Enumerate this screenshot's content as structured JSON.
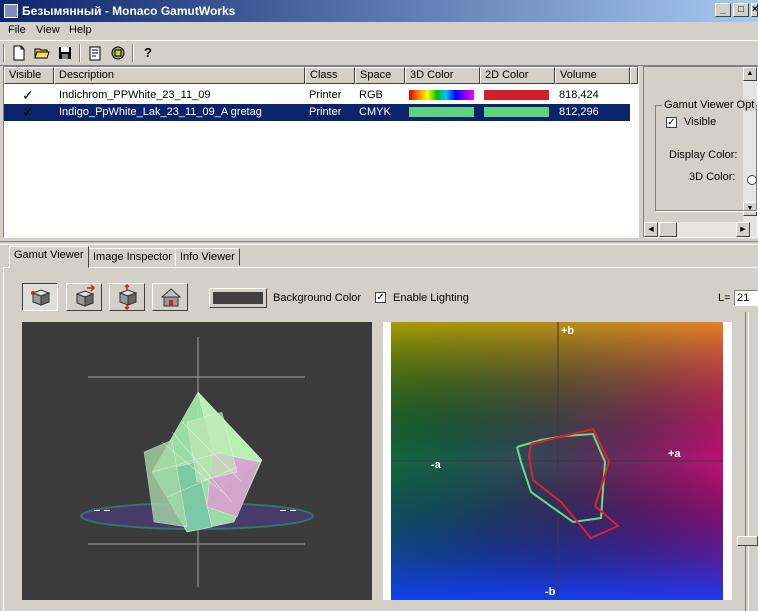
{
  "window": {
    "title": "Безымянный - Monaco GamutWorks"
  },
  "menu": [
    "File",
    "View",
    "Help"
  ],
  "toolbar": {
    "icons": [
      "new-icon",
      "open-icon",
      "save-icon",
      "properties-icon",
      "import-icon",
      "help-icon"
    ],
    "help_glyph": "?"
  },
  "list": {
    "columns": [
      "Visible",
      "Description",
      "Class",
      "Space",
      "3D Color",
      "2D Color",
      "Volume"
    ],
    "rows": [
      {
        "visible": "✓",
        "description": "Indichrom_PPWhite_23_11_09",
        "class": "Printer",
        "space": "RGB",
        "color3d": "rainbow",
        "color2d": "#d0202a",
        "volume": "818,424",
        "selected": false
      },
      {
        "visible": "✓",
        "description": "Indigo_PpWhite_Lak_23_11_09_A gretag",
        "class": "Printer",
        "space": "CMYK",
        "color3d": "#5ed17c",
        "color2d": "#5ed17c",
        "volume": "812,296",
        "selected": true
      }
    ]
  },
  "options_panel": {
    "group_title": "Gamut Viewer Opt",
    "visible_label": "Visible",
    "display_color_label": "Display Color:",
    "color3d_label": "3D Color:"
  },
  "tabs": [
    "Gamut Viewer",
    "Image Inspector",
    "Info Viewer"
  ],
  "viewer": {
    "background_color_label": "Background Color",
    "background_color": "#404040",
    "enable_lighting_label": "Enable Lighting",
    "enable_lighting": true,
    "l_label": "L=",
    "l_value": "21"
  },
  "plot2d": {
    "label_plus_b": "+b",
    "label_minus_b": "-b",
    "label_plus_a": "+a",
    "label_minus_a": "-a"
  }
}
